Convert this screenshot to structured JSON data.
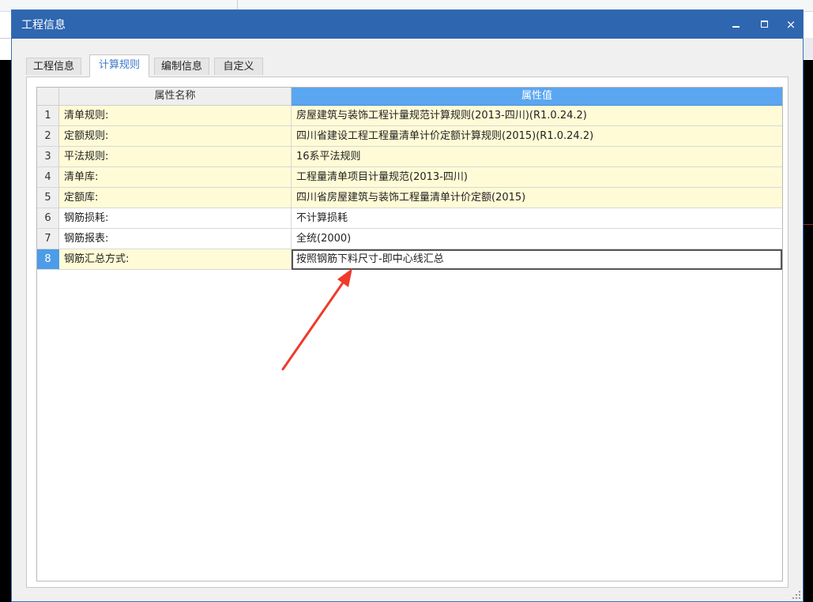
{
  "window": {
    "title": "工程信息",
    "close_glyph": "×"
  },
  "tabs": [
    {
      "label": "工程信息",
      "active": false
    },
    {
      "label": "计算规则",
      "active": true
    },
    {
      "label": "编制信息",
      "active": false
    },
    {
      "label": "自定义",
      "active": false
    }
  ],
  "table": {
    "headers": {
      "name": "属性名称",
      "value": "属性值"
    },
    "rows": [
      {
        "index": "1",
        "name": "清单规则:",
        "value": "房屋建筑与装饰工程计量规范计算规则(2013-四川)(R1.0.24.2)"
      },
      {
        "index": "2",
        "name": "定额规则:",
        "value": "四川省建设工程工程量清单计价定额计算规则(2015)(R1.0.24.2)"
      },
      {
        "index": "3",
        "name": "平法规则:",
        "value": "16系平法规则"
      },
      {
        "index": "4",
        "name": "清单库:",
        "value": "工程量清单项目计量规范(2013-四川)"
      },
      {
        "index": "5",
        "name": "定额库:",
        "value": "四川省房屋建筑与装饰工程量清单计价定额(2015)"
      },
      {
        "index": "6",
        "name": "钢筋损耗:",
        "value": "不计算损耗"
      },
      {
        "index": "7",
        "name": "钢筋报表:",
        "value": "全统(2000)"
      },
      {
        "index": "8",
        "name": "钢筋汇总方式:",
        "value": "按照钢筋下料尺寸-即中心线汇总"
      }
    ]
  },
  "colors": {
    "titlebar": "#2f66b0",
    "header_value_bg": "#5aa6f0",
    "locked_row_bg": "#fefbd6",
    "selected_index_bg": "#4d9ce8",
    "annotation_arrow": "#f03a2a"
  }
}
